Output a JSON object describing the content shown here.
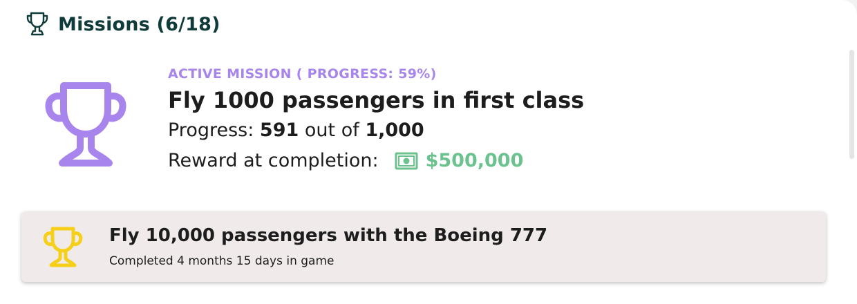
{
  "header": {
    "title": "Missions (6/18)",
    "icon": "trophy-outline-icon",
    "title_color": "#0f3b3a"
  },
  "active_mission": {
    "label": "ACTIVE MISSION ( PROGRESS: 59%)",
    "progress_percent": 59,
    "title": "Fly 1000 passengers in first class",
    "progress_prefix": "Progress:",
    "progress_current": "591",
    "progress_middle": "out of",
    "progress_target": "1,000",
    "reward_label": "Reward at completion:",
    "reward_icon": "money-bill-icon",
    "reward_value": "$500,000",
    "icon": "trophy-icon",
    "accent_color": "#a785ec",
    "reward_color": "#6cc28e"
  },
  "completed_missions": [
    {
      "title": "Fly 10,000 passengers with the Boeing 777",
      "subtitle": "Completed 4 months 15 days in game",
      "icon": "trophy-icon",
      "icon_color": "#f5cf1a"
    }
  ]
}
